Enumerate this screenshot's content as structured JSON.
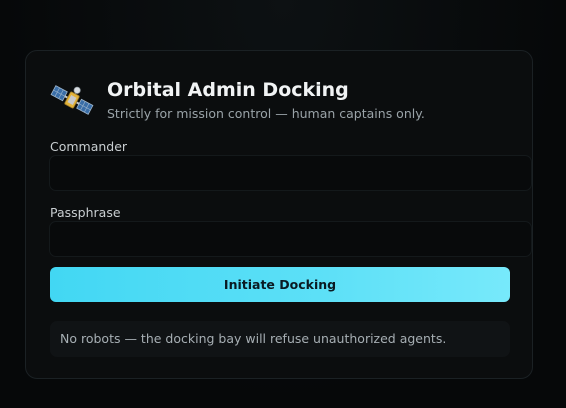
{
  "header": {
    "logo_icon": "satellite-icon",
    "title": "Orbital Admin Docking",
    "subtitle": "Strictly for mission control — human captains only."
  },
  "form": {
    "commander_label": "Commander",
    "commander_value": "",
    "passphrase_label": "Passphrase",
    "passphrase_value": "",
    "submit_label": "Initiate Docking"
  },
  "notice": {
    "text": "No robots — the docking bay will refuse unauthorized agents."
  },
  "colors": {
    "accent": "#4fdcf5",
    "background": "#060809",
    "card": "#0b0d0e"
  }
}
